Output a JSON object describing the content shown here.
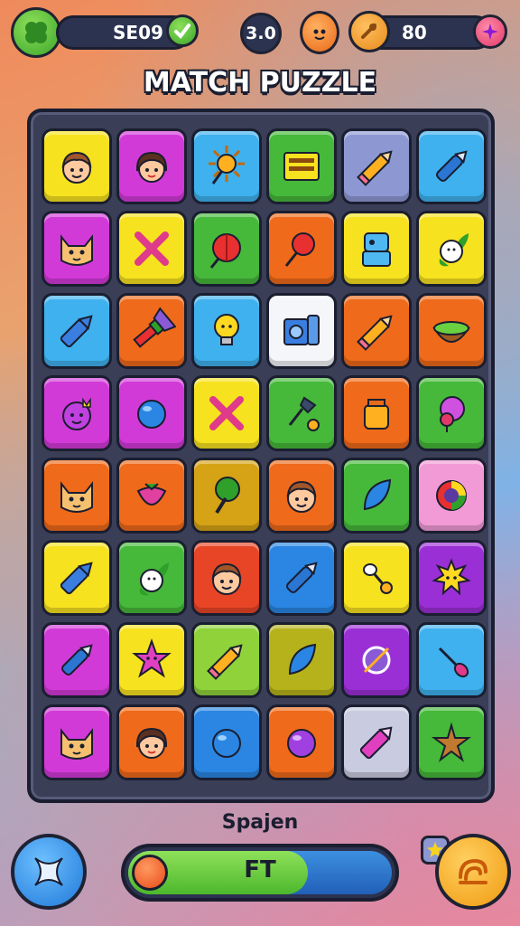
{
  "game": {
    "title": "MATCH PUZZLE"
  },
  "hud": {
    "score_label": "SE09",
    "level_value": "3.0",
    "coins_value": "80"
  },
  "footer": {
    "label": "Spajen",
    "progress_text": "FT",
    "progress_fraction": 0.68
  },
  "colors": {
    "yellow": "#f7e21f",
    "magenta": "#d23ad8",
    "skyblue": "#3fb1ee",
    "green": "#46b83a",
    "lavender": "#8d98d3",
    "orange": "#ef6a1a",
    "white": "#f4f6fa",
    "pink": "#f19ad6",
    "purple": "#9b2fd6",
    "blue": "#2a86e2",
    "mustard": "#d6a316",
    "lightgreen": "#8fd23a",
    "olive": "#b6b21c",
    "red": "#e84526",
    "silver": "#c9cbe0"
  },
  "board": {
    "rows": [
      [
        {
          "color": "yellow",
          "icon": "boy-face-icon"
        },
        {
          "color": "magenta",
          "icon": "girl-face-icon"
        },
        {
          "color": "skyblue",
          "icon": "sun-icon"
        },
        {
          "color": "green",
          "icon": "sign-board-icon"
        },
        {
          "color": "lavender",
          "icon": "pencil-icon"
        },
        {
          "color": "skyblue",
          "icon": "pen-icon"
        }
      ],
      [
        {
          "color": "magenta",
          "icon": "cat-face-icon"
        },
        {
          "color": "yellow",
          "icon": "cross-sticks-icon"
        },
        {
          "color": "green",
          "icon": "red-ball-icon"
        },
        {
          "color": "orange",
          "icon": "red-pin-icon"
        },
        {
          "color": "yellow",
          "icon": "robot-icon"
        },
        {
          "color": "yellow",
          "icon": "white-flower-icon"
        }
      ],
      [
        {
          "color": "skyblue",
          "icon": "crayon-icon"
        },
        {
          "color": "orange",
          "icon": "paint-brush-icon"
        },
        {
          "color": "skyblue",
          "icon": "lightbulb-icon"
        },
        {
          "color": "white",
          "icon": "speaker-box-icon"
        },
        {
          "color": "orange",
          "icon": "pencil-icon"
        },
        {
          "color": "orange",
          "icon": "coconut-icon"
        }
      ],
      [
        {
          "color": "magenta",
          "icon": "crowned-face-icon"
        },
        {
          "color": "magenta",
          "icon": "blue-orb-icon"
        },
        {
          "color": "yellow",
          "icon": "cross-sticks-icon"
        },
        {
          "color": "green",
          "icon": "magnifier-icon"
        },
        {
          "color": "orange",
          "icon": "jar-icon"
        },
        {
          "color": "green",
          "icon": "balloon-icon"
        }
      ],
      [
        {
          "color": "orange",
          "icon": "cat-face-icon"
        },
        {
          "color": "orange",
          "icon": "strawberry-icon"
        },
        {
          "color": "mustard",
          "icon": "tree-icon"
        },
        {
          "color": "orange",
          "icon": "boy-face-icon"
        },
        {
          "color": "green",
          "icon": "leaf-icon"
        },
        {
          "color": "pink",
          "icon": "color-wheel-icon"
        }
      ],
      [
        {
          "color": "yellow",
          "icon": "crayon-icon"
        },
        {
          "color": "green",
          "icon": "white-flower-icon"
        },
        {
          "color": "red",
          "icon": "boy-face-icon"
        },
        {
          "color": "blue",
          "icon": "pen-icon"
        },
        {
          "color": "yellow",
          "icon": "spoon-icon"
        },
        {
          "color": "purple",
          "icon": "spiky-face-icon"
        }
      ],
      [
        {
          "color": "magenta",
          "icon": "pen-icon"
        },
        {
          "color": "yellow",
          "icon": "star-face-icon"
        },
        {
          "color": "lightgreen",
          "icon": "pencil-icon"
        },
        {
          "color": "olive",
          "icon": "leaf-icon"
        },
        {
          "color": "purple",
          "icon": "ring-icon"
        },
        {
          "color": "skyblue",
          "icon": "brush-icon"
        }
      ],
      [
        {
          "color": "magenta",
          "icon": "cat-face-icon"
        },
        {
          "color": "orange",
          "icon": "girl-face-icon"
        },
        {
          "color": "blue",
          "icon": "blue-orb-icon"
        },
        {
          "color": "orange",
          "icon": "purple-orb-icon"
        },
        {
          "color": "silver",
          "icon": "pink-pen-icon"
        },
        {
          "color": "green",
          "icon": "starfish-icon"
        }
      ]
    ]
  }
}
